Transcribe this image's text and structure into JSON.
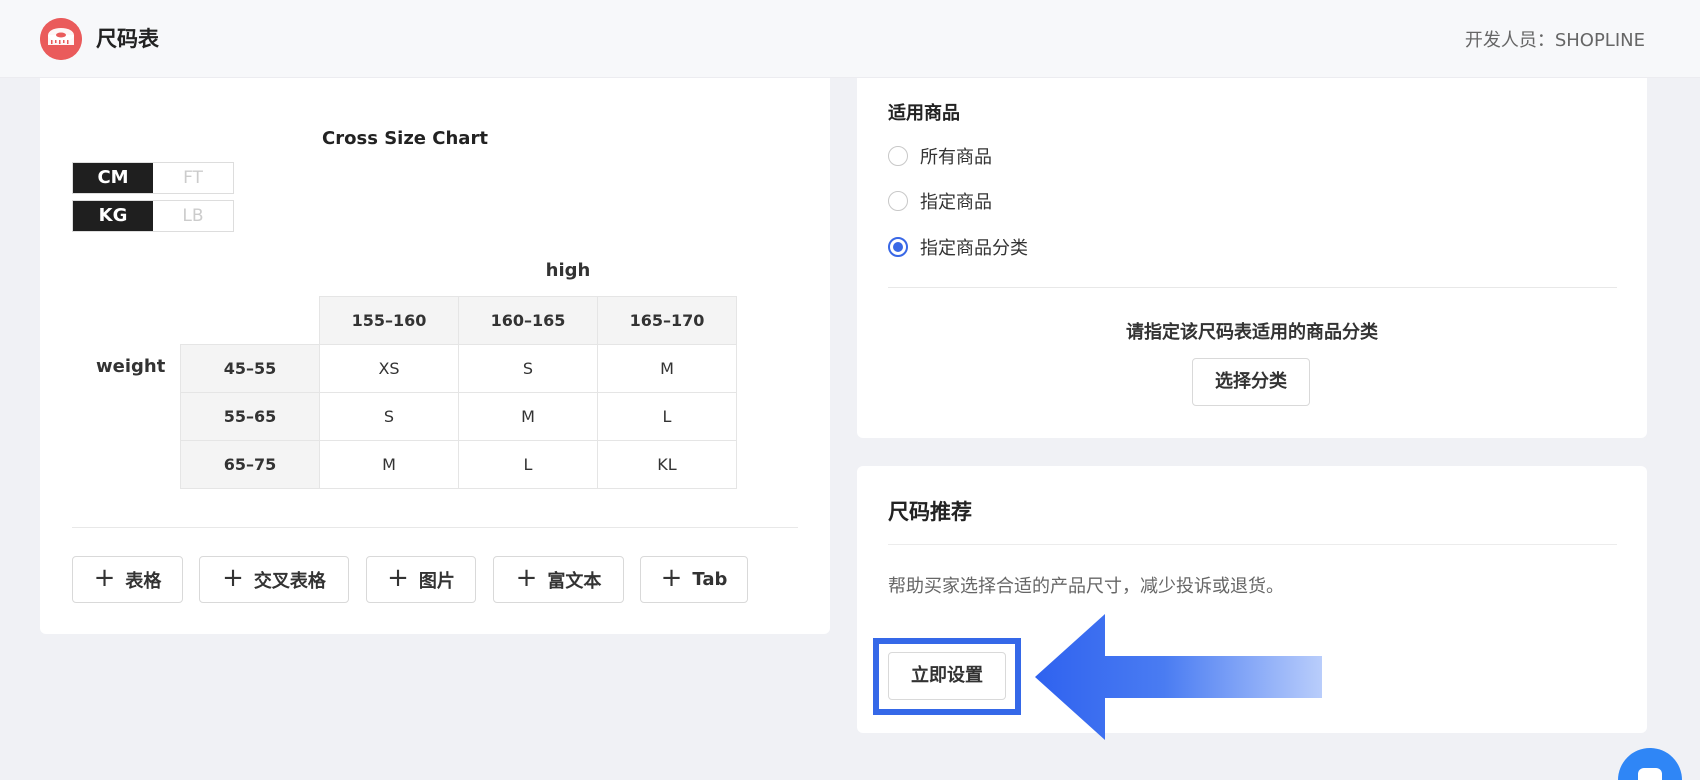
{
  "header": {
    "app_title": "尺码表",
    "developer": "开发人员：SHOPLINE"
  },
  "size_chart": {
    "title": "Cross Size Chart",
    "unit_toggles": [
      {
        "active": "CM",
        "inactive": "FT"
      },
      {
        "active": "KG",
        "inactive": "LB"
      }
    ],
    "column_axis": "high",
    "row_axis": "weight",
    "columns": [
      "155–160",
      "160–165",
      "165–170"
    ],
    "rows": [
      {
        "label": "45–55",
        "cells": [
          "XS",
          "S",
          "M"
        ]
      },
      {
        "label": "55–65",
        "cells": [
          "S",
          "M",
          "L"
        ]
      },
      {
        "label": "65–75",
        "cells": [
          "M",
          "L",
          "KL"
        ]
      }
    ]
  },
  "add_buttons": [
    "表格",
    "交叉表格",
    "图片",
    "富文本",
    "Tab"
  ],
  "applicable_products": {
    "label": "适用商品",
    "options": [
      "所有商品",
      "指定商品",
      "指定商品分类"
    ],
    "selected": "指定商品分类",
    "hint": "请指定该尺码表适用的商品分类",
    "select_button": "选择分类"
  },
  "recommendation": {
    "title": "尺码推荐",
    "description": "帮助买家选择合适的产品尺寸，减少投诉或退货。",
    "setup_button": "立即设置"
  },
  "colors": {
    "accent": "#3968e6",
    "highlight": "#3568e8",
    "logo": "#ea5b5b",
    "chat": "#2f86f6"
  }
}
